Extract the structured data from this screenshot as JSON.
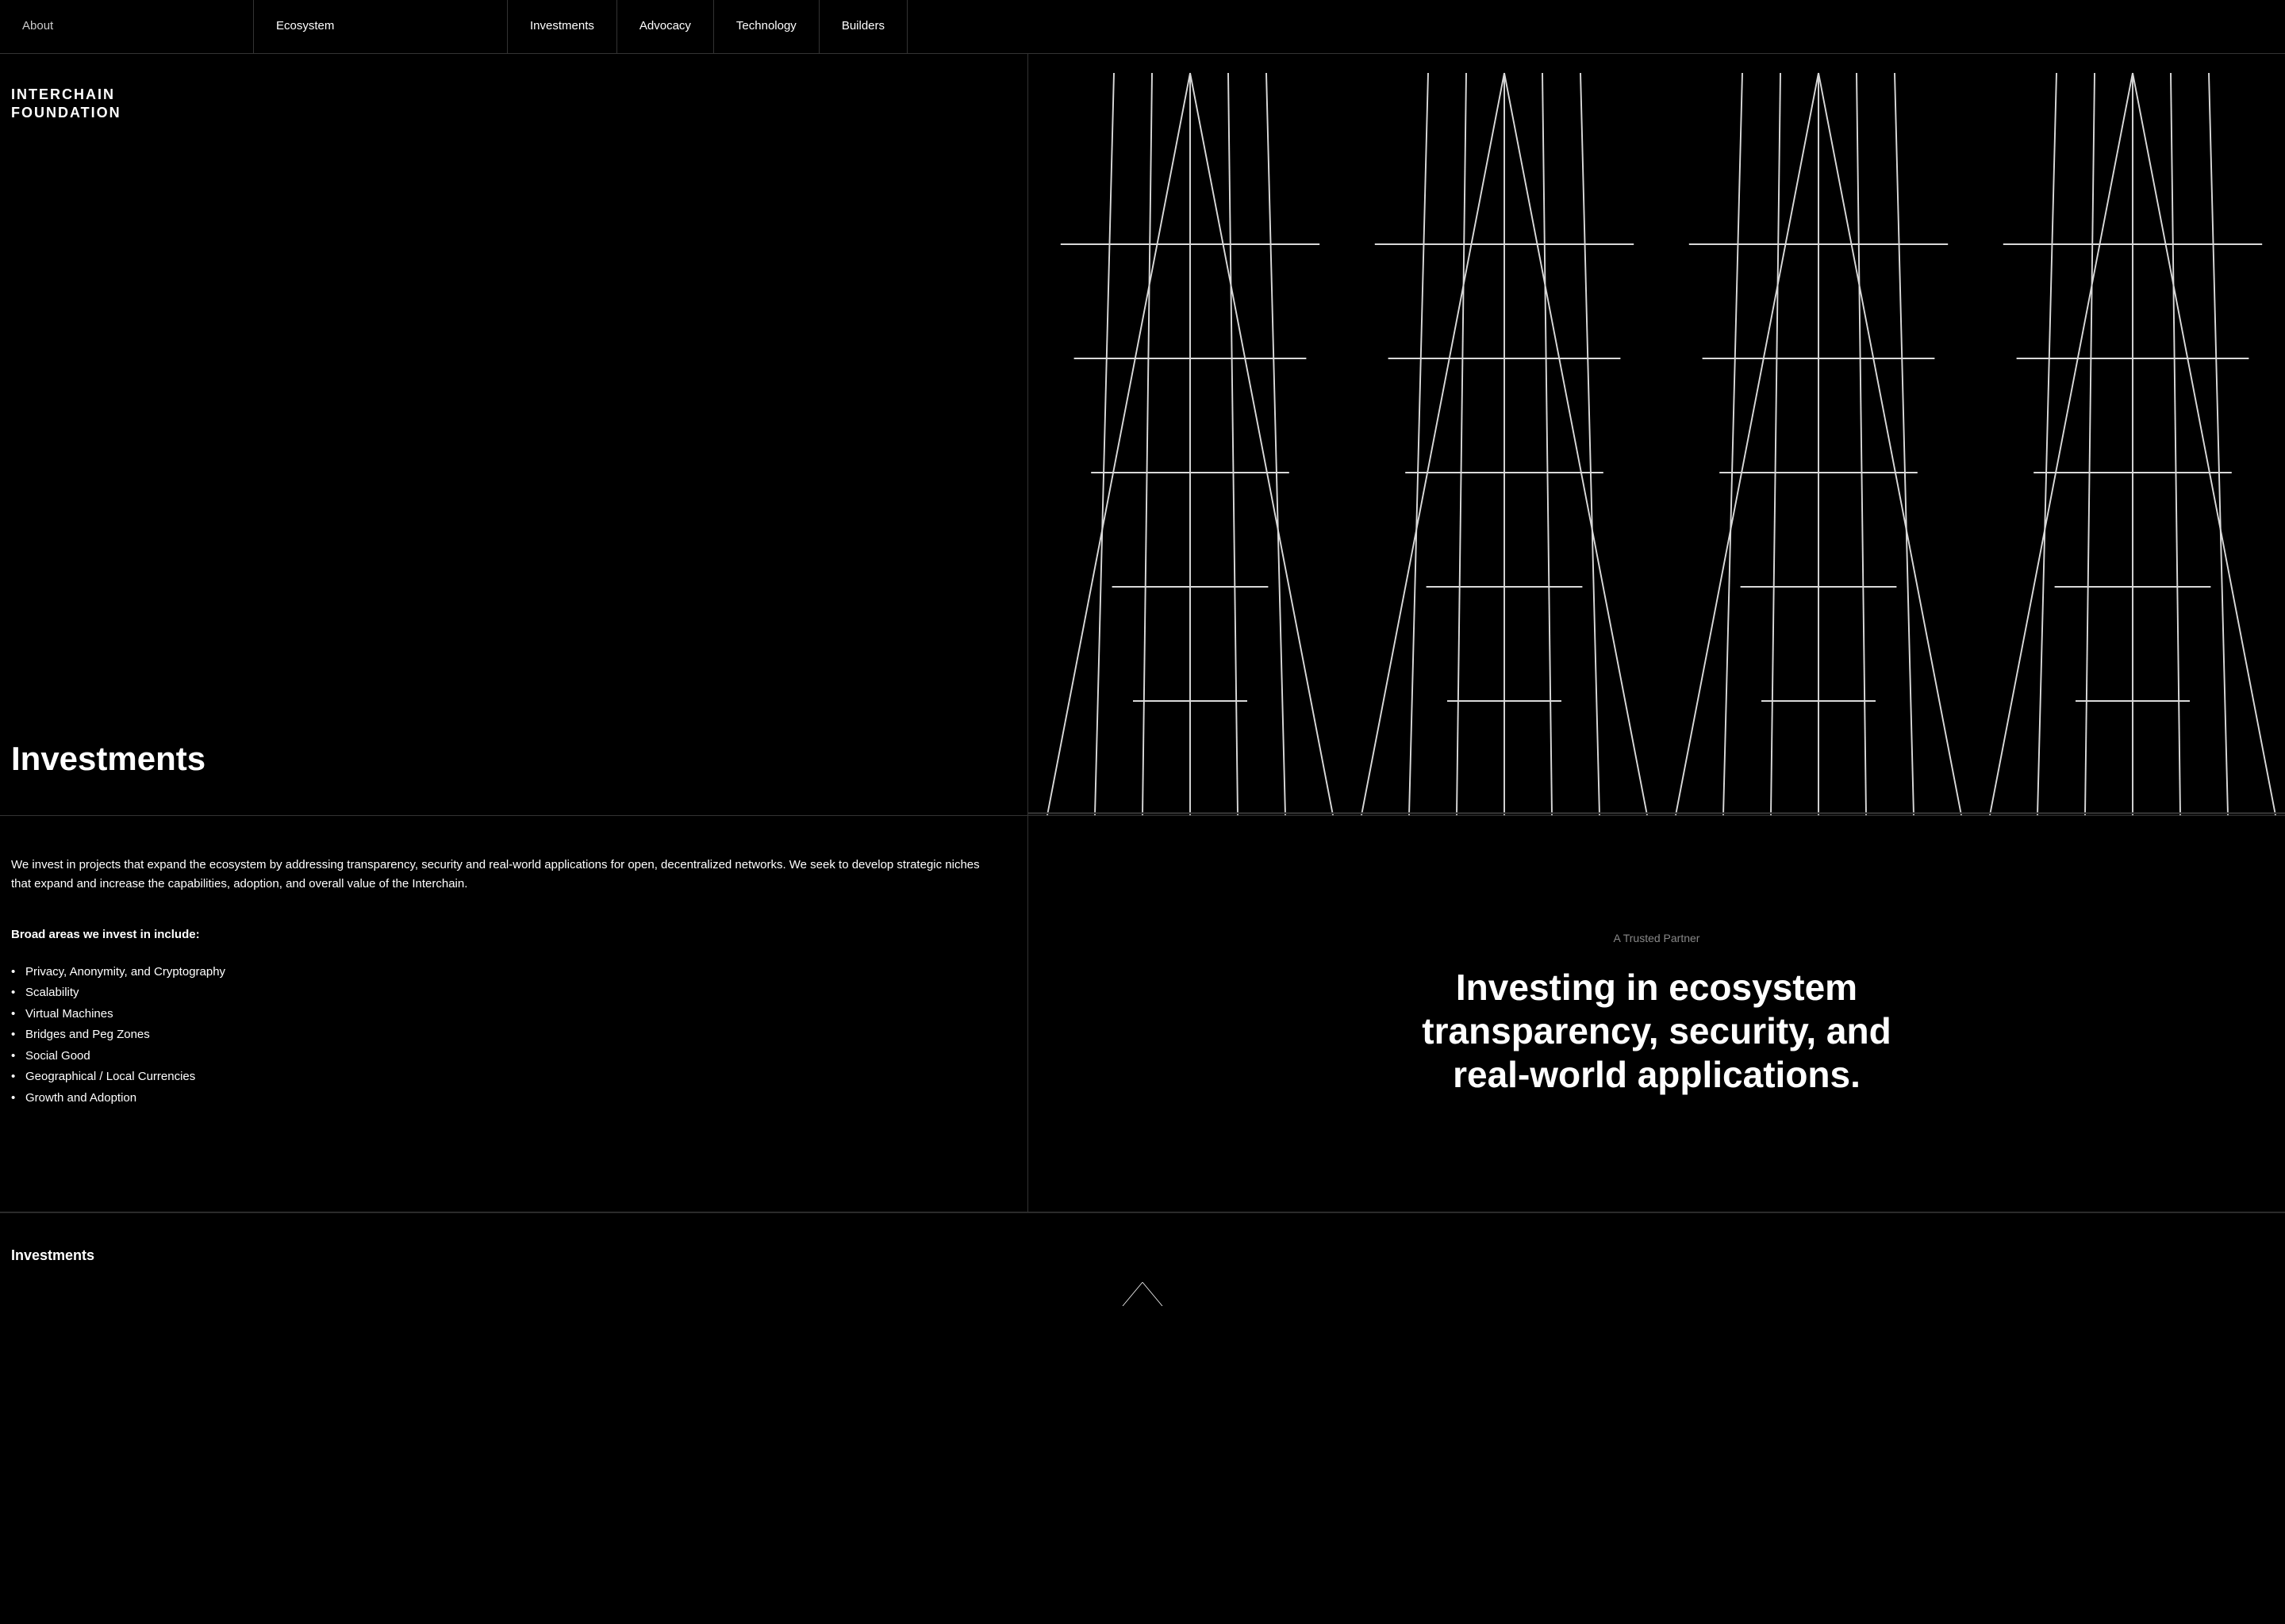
{
  "nav": {
    "items": [
      {
        "label": "About",
        "active": false
      },
      {
        "label": "Ecosystem",
        "active": false
      },
      {
        "label": "Investments",
        "active": true
      },
      {
        "label": "Advocacy",
        "active": false
      },
      {
        "label": "Technology",
        "active": false
      },
      {
        "label": "Builders",
        "active": false
      }
    ]
  },
  "hero": {
    "logo_line1": "INTERCHAIN",
    "logo_line2": "FOUNDATION",
    "title": "Investments"
  },
  "content": {
    "description": "We invest in projects that expand the ecosystem by addressing transparency, security and real-world applications for open, decentralized networks. We seek to develop strategic niches that expand and increase the capabilities, adoption, and overall value of the Interchain.",
    "broad_heading": "Broad areas we invest in include:",
    "invest_list": [
      "Privacy, Anonymity, and Cryptography",
      "Scalability",
      "Virtual Machines",
      "Bridges and Peg Zones",
      "Social Good",
      "Geographical / Local Currencies",
      "Growth and Adoption"
    ]
  },
  "trusted": {
    "label": "A Trusted Partner",
    "tagline": "Investing in ecosystem transparency, security, and real-world applications."
  },
  "footer": {
    "label": "Investments"
  },
  "colors": {
    "bg": "#000000",
    "text": "#ffffff",
    "border": "#333333",
    "muted": "#888888"
  }
}
